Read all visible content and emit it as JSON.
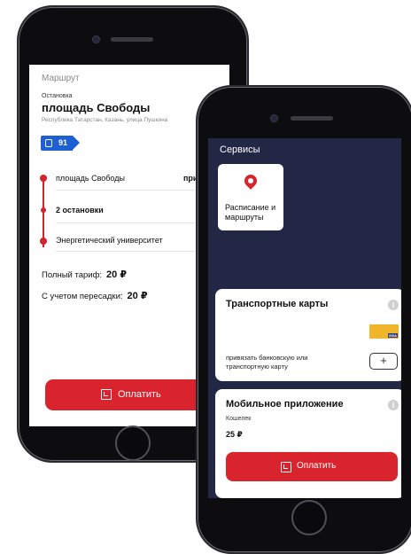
{
  "left_phone": {
    "route_label": "Маршрут",
    "stop_caption": "Остановка",
    "stop_title": "площадь Свободы",
    "stop_address": "Республика Татарстан, Казань, улица Пушкина",
    "bus_number": "91",
    "stops": [
      {
        "name": "площадь Свободы",
        "right": "приб"
      },
      {
        "name": "2 остановки"
      },
      {
        "name": "Энергетический университет"
      }
    ],
    "fares": [
      {
        "label": "Полный тариф:",
        "value": "20 ₽"
      },
      {
        "label": "С учетом пересадки:",
        "value": "20 ₽"
      }
    ],
    "pay_button": "Оплатить"
  },
  "right_phone": {
    "services_title": "Сервисы",
    "service_tile": {
      "label": "Расписание и маршруты",
      "icon": "map-pin-icon"
    },
    "transport_cards": {
      "title": "Транспортные карты",
      "card_brand": "VISA",
      "link_text": "привязать банковскую или транспортную карту",
      "add_symbol": "+"
    },
    "mobile_app": {
      "title": "Мобильное приложение",
      "wallet_label": "Кошелек",
      "wallet_value": "25 ₽",
      "pay_button": "Оплатить"
    },
    "info_symbol": "i"
  },
  "colors": {
    "accent_red": "#d9232d",
    "bus_blue": "#1e5fd4",
    "services_bg": "#232746"
  }
}
